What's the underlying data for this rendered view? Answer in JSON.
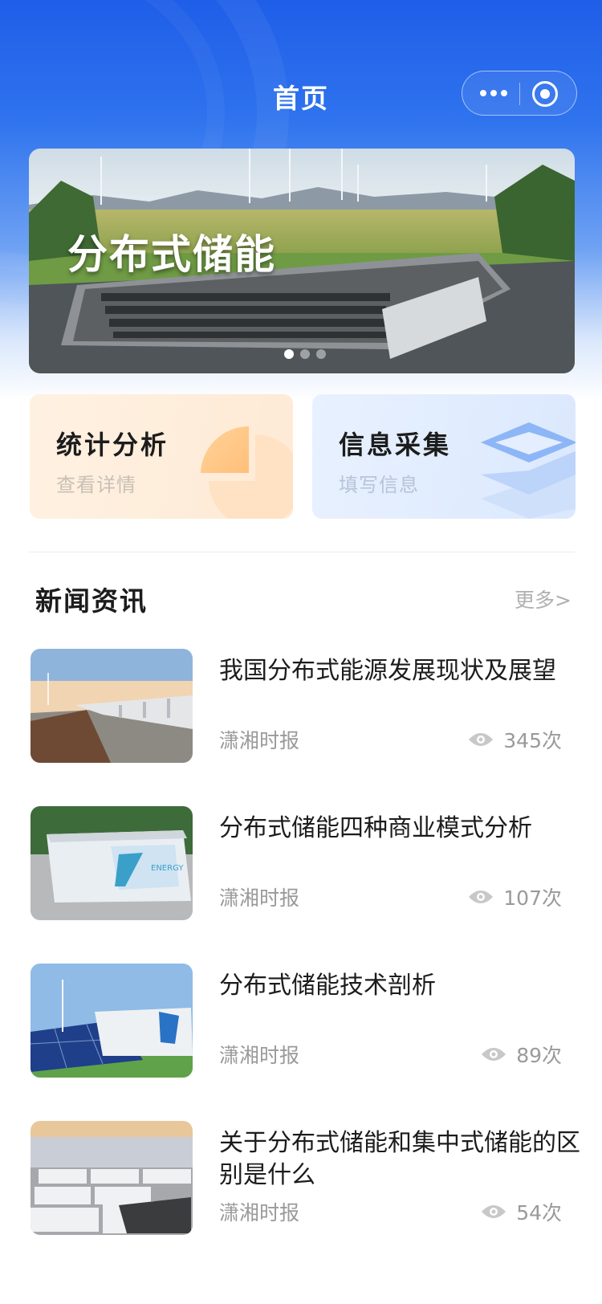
{
  "nav": {
    "title": "首页"
  },
  "banner": {
    "title": "分布式储能"
  },
  "quick_cards": [
    {
      "title": "统计分析",
      "subtitle": "查看详情"
    },
    {
      "title": "信息采集",
      "subtitle": "填写信息"
    }
  ],
  "news": {
    "section_title": "新闻资讯",
    "more_label": "更多>",
    "items": [
      {
        "title": "我国分布式能源发展现状及展望",
        "source": "潇湘时报",
        "views": "345次"
      },
      {
        "title": "分布式储能四种商业模式分析",
        "source": "潇湘时报",
        "views": "107次"
      },
      {
        "title": "分布式储能技术剖析",
        "source": "潇湘时报",
        "views": "89次"
      },
      {
        "title": "关于分布式储能和集中式储能的区别是什么",
        "source": "潇湘时报",
        "views": "54次"
      }
    ]
  }
}
